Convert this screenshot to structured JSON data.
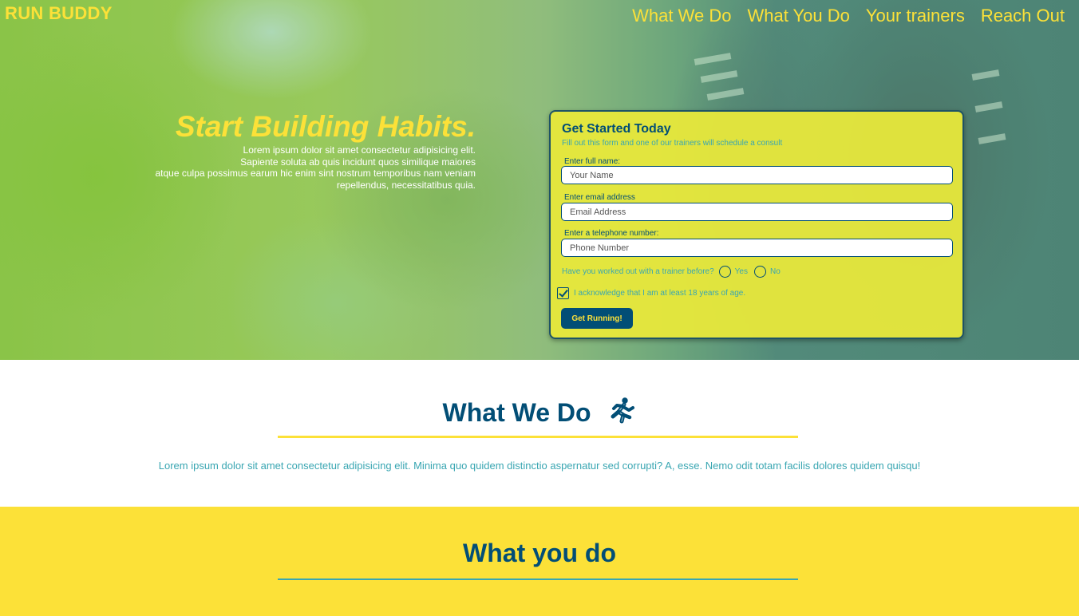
{
  "brand": "RUN BUDDY",
  "nav": [
    "What We Do",
    "What You Do",
    "Your trainers",
    "Reach Out"
  ],
  "hero": {
    "title": "Start Building Habits.",
    "text_lines": [
      "Lorem ipsum dolor sit amet consectetur adipisicing elit.",
      "Sapiente soluta ab quis incidunt quos similique maiores",
      "atque culpa possimus earum hic enim sint nostrum temporibus nam veniam",
      "repellendus, necessitatibus quia."
    ]
  },
  "form": {
    "title": "Get Started Today",
    "subtitle": "Fill out this form and one of our trainers will schedule a consult",
    "name_label": "Enter full name:",
    "name_placeholder": "Your Name",
    "email_label": "Enter email address",
    "email_placeholder": "Email Address",
    "phone_label": "Enter a telephone number:",
    "phone_placeholder": "Phone Number",
    "trainer_question": "Have you worked out with a trainer before?",
    "yes_label": "Yes",
    "no_label": "No",
    "age_ack": "I acknowledge that I am at least 18 years of age.",
    "age_ack_checked": true,
    "submit_label": "Get Running!"
  },
  "what_we_do": {
    "heading": "What We Do",
    "icon": "runner-icon",
    "text": "Lorem ipsum dolor sit amet consectetur adipisicing elit. Minima quo quidem distinctio aspernatur sed corrupti? A, esse. Nemo odit totam facilis dolores quidem quisqu!"
  },
  "what_you_do": {
    "heading": "What you do"
  },
  "colors": {
    "primary": "#024e76",
    "accent": "#fce138",
    "secondary": "#39a6b2"
  }
}
